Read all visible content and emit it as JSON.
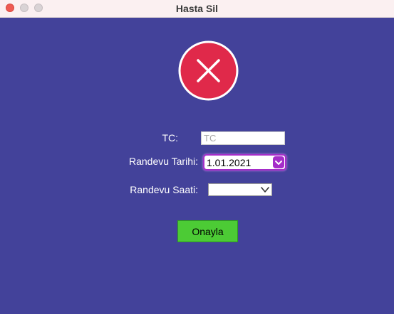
{
  "window": {
    "title": "Hasta Sil"
  },
  "form": {
    "tc_label": "TC:",
    "tc_placeholder": "TC",
    "tc_value": "",
    "date_label": "Randevu Tarihi:",
    "date_value": "1.01.2021",
    "time_label": "Randevu Saati:",
    "time_value": "",
    "confirm_label": "Onayla"
  },
  "icons": {
    "header_icon": "close-circle-icon",
    "date_dropdown": "chevron-down-icon",
    "time_dropdown": "chevron-down-icon"
  },
  "colors": {
    "background": "#43429a",
    "delete_icon": "#e0294a",
    "accent": "#a52dc9",
    "confirm_button": "#4ccb35"
  }
}
